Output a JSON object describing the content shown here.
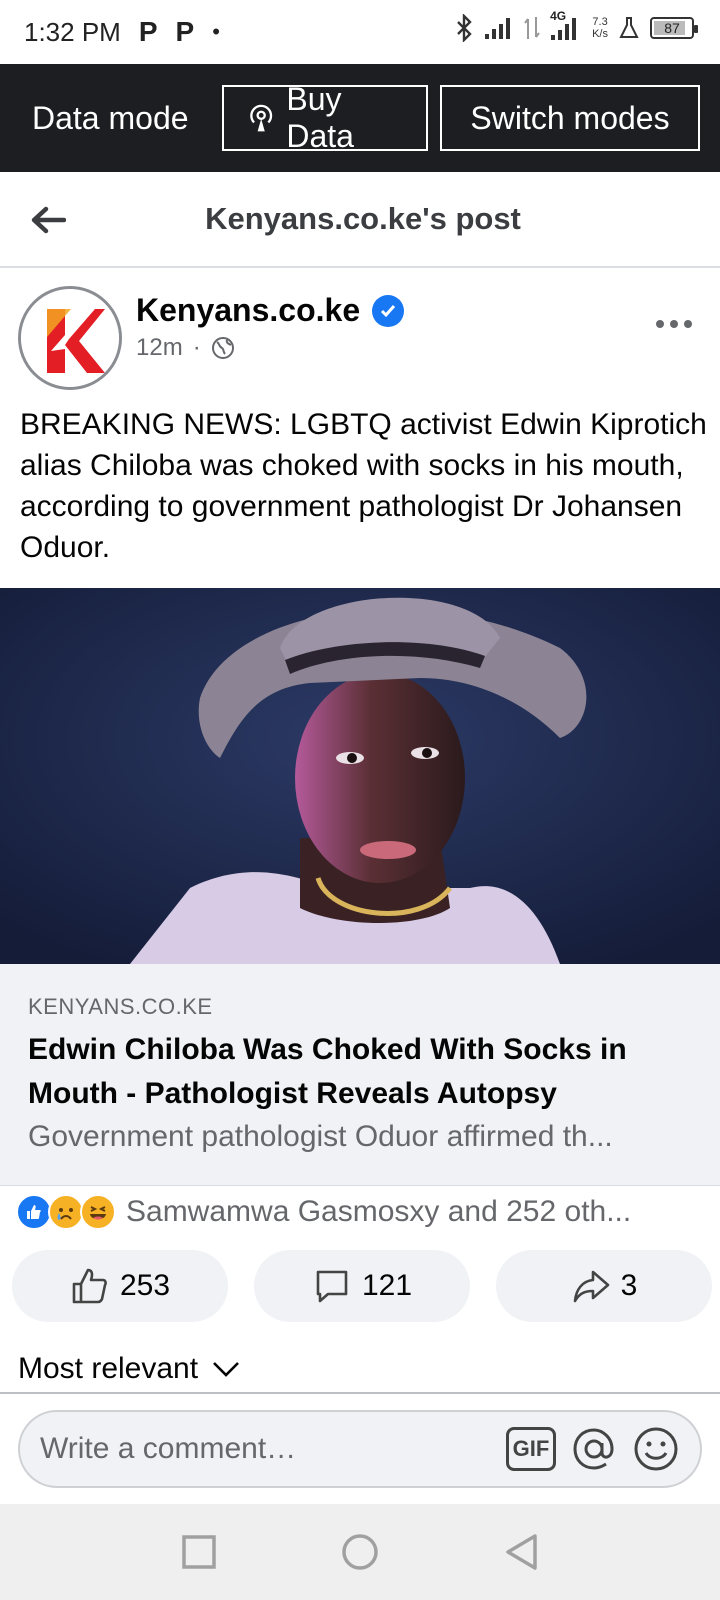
{
  "status_bar": {
    "time": "1:32 PM",
    "notif1": "P",
    "notif2": "P",
    "dot": "•",
    "net_type": "4G",
    "net_speed_value": "7.3",
    "net_speed_unit": "K/s",
    "battery": "87",
    "battery_level": 0.87
  },
  "data_bar": {
    "mode_label": "Data mode",
    "buy_label": "Buy Data",
    "switch_label": "Switch modes"
  },
  "header": {
    "title": "Kenyans.co.ke's post"
  },
  "post": {
    "page_name": "Kenyans.co.ke",
    "time": "12m",
    "separator": "·",
    "text": "BREAKING NEWS: LGBTQ activist Edwin Kiprotich alias Chiloba was choked with socks in his mouth, according to government pathologist Dr Johansen Oduor."
  },
  "link": {
    "domain": "KENYANS.CO.KE",
    "title": "Edwin Chiloba Was Choked With Socks in Mouth - Pathologist Reveals Autopsy",
    "description": "Government pathologist Oduor affirmed th..."
  },
  "reactions": {
    "summary": "Samwamwa Gasmosxy and 252 oth...",
    "icons": [
      "like-icon",
      "sad-icon",
      "haha-icon"
    ]
  },
  "actions": {
    "likes": "253",
    "comments": "121",
    "shares": "3"
  },
  "comments": {
    "sort_label": "Most relevant"
  },
  "composer": {
    "placeholder": "Write a comment…",
    "gif_label": "GIF"
  },
  "colors": {
    "brand_blue": "#1877f2",
    "data_bar_bg": "#1c1e21",
    "brand_red": "#e31e24"
  }
}
